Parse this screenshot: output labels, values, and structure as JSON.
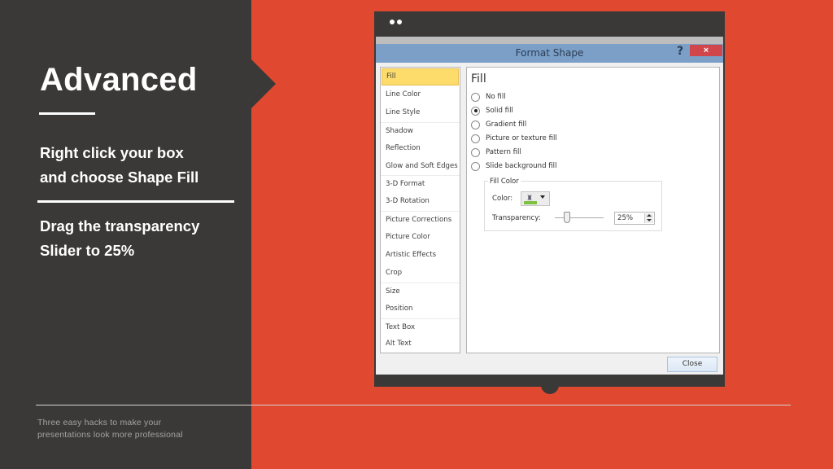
{
  "slide": {
    "title": "Advanced",
    "steps": [
      {
        "line1": "Right click your box",
        "line2": "and choose Shape Fill"
      },
      {
        "line1": "Drag the transparency",
        "line2": "Slider to 25%"
      }
    ],
    "footer": {
      "line1": "Three easy hacks to make your",
      "line2": "presentations look more professional"
    },
    "colors": {
      "accent": "#e0482f",
      "panel": "#3b3938",
      "text": "#ffffff"
    }
  },
  "dialog": {
    "title": "Format Shape",
    "help_label": "?",
    "close_x_label": "×",
    "nav_items": [
      {
        "label": "Fill",
        "selected": true
      },
      {
        "label": "Line Color"
      },
      {
        "label": "Line Style"
      },
      {
        "label": "Shadow"
      },
      {
        "label": "Reflection"
      },
      {
        "label": "Glow and Soft Edges"
      },
      {
        "label": "3-D Format"
      },
      {
        "label": "3-D Rotation"
      },
      {
        "label": "Picture Corrections"
      },
      {
        "label": "Picture Color"
      },
      {
        "label": "Artistic Effects"
      },
      {
        "label": "Crop"
      },
      {
        "label": "Size"
      },
      {
        "label": "Position"
      },
      {
        "label": "Text Box"
      },
      {
        "label": "Alt Text"
      }
    ],
    "content": {
      "heading": "Fill",
      "options": [
        {
          "label": "No fill",
          "checked": false
        },
        {
          "label": "Solid fill",
          "checked": true
        },
        {
          "label": "Gradient fill",
          "checked": false
        },
        {
          "label": "Picture or texture fill",
          "checked": false
        },
        {
          "label": "Pattern fill",
          "checked": false
        },
        {
          "label": "Slide background fill",
          "checked": false
        }
      ],
      "fill_color": {
        "legend": "Fill Color",
        "color_label": "Color:",
        "color_value": "#7cc242",
        "transparency_label": "Transparency:",
        "transparency_value": "25%",
        "transparency_fraction": 0.25
      }
    },
    "close_button_label": "Close"
  }
}
